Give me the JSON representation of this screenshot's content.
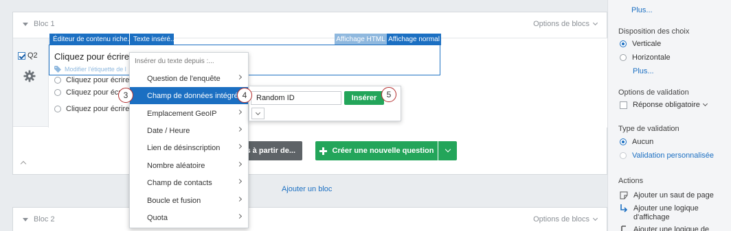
{
  "block1": {
    "title": "Bloc 1",
    "options": "Options de blocs"
  },
  "block2": {
    "title": "Bloc 2",
    "options": "Options de blocs"
  },
  "question": {
    "id": "Q2",
    "text": "Cliquez pour écrire la",
    "tag_label": "Modifier l'étiquette de l",
    "choices": [
      "Cliquez pour écrire",
      "Cliquez pour écri",
      "Cliquez pour écrire C"
    ]
  },
  "editor_tabs": {
    "rich": "Éditeur de contenu riche...",
    "piped": "Texte inséré...",
    "html": "Affichage HTML",
    "normal": "Affichage normal"
  },
  "piped_menu": {
    "header": "Insérer du texte depuis :...",
    "items": [
      "Question de l'enquête",
      "Champ de données intégrées",
      "Emplacement GeoIP",
      "Date / Heure",
      "Lien de désinscription",
      "Nombre aléatoire",
      "Champ de contacts",
      "Boucle et fusion",
      "Quota"
    ],
    "active_index": 1
  },
  "submenu": {
    "field_value": "Random ID",
    "insert_label": "Insérer"
  },
  "callouts": [
    "3",
    "4",
    "5"
  ],
  "actions": {
    "import_label": "s à partir de...",
    "create_label": "Créer une nouvelle question",
    "add_block": "Ajouter un bloc"
  },
  "sidebar": {
    "plus_top": "Plus...",
    "choice_layout": {
      "heading": "Disposition des choix",
      "options": [
        "Verticale",
        "Horizontale"
      ],
      "selected": 0,
      "more": "Plus..."
    },
    "validation_options": {
      "heading": "Options de validation",
      "required_label": "Réponse obligatoire"
    },
    "validation_type": {
      "heading": "Type de validation",
      "options": [
        "Aucun",
        "Validation personnalisée"
      ],
      "selected": 0
    },
    "actions": {
      "heading": "Actions",
      "items": [
        "Ajouter un saut de page",
        "Ajouter une logique d'affichage",
        "Ajouter une logique de"
      ]
    }
  },
  "colors": {
    "accent": "#1b6fc2",
    "green": "#23a55a",
    "callout_border": "#b22a2a",
    "tab_gray": "#8fb8de"
  }
}
